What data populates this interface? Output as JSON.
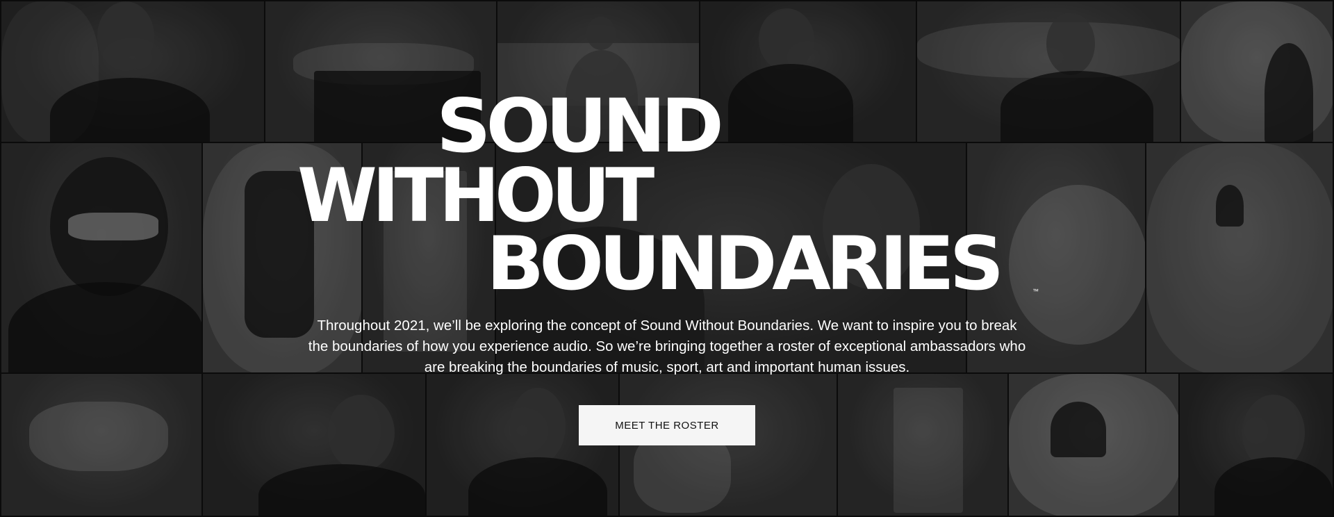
{
  "hero": {
    "title_lines": [
      "SOUND",
      "WITHOUT",
      "BOUNDARIES"
    ],
    "trademark": "™",
    "intro": "Throughout 2021, we’ll be exploring the concept of Sound Without Boundaries. We want to inspire you to break the boundaries of how you experience audio. So we’re bringing together a roster of exceptional ambassadors who are breaking the boundaries of music, sport, art and important human issues.",
    "cta_label": "MEET THE ROSTER"
  },
  "mosaic_tiles": [
    "ambassador-photo-man-tshirt",
    "skateboarder-rail-photo",
    "skater-building-photo",
    "snowboarder-beanie-photo",
    "skater-holding-board-photo",
    "snow-rider-photo",
    "headphones-sunglasses-photo",
    "hiker-poles-photo",
    "city-street-photo",
    "woman-portrait-photo",
    "surfer-wave-photo",
    "snowboard-jump-photo",
    "surf-spray-photo",
    "camo-jacket-photo",
    "artist-portrait-photo",
    "graffiti-wall-photo",
    "skyline-rider-photo",
    "snowboarder-powder-photo",
    "woman-profile-photo"
  ]
}
